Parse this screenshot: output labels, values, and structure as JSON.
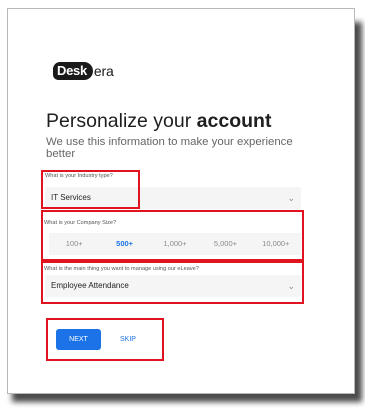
{
  "logo": {
    "badge_text": "Desk",
    "rest_text": "era"
  },
  "heading": {
    "title_prefix": "Personalize your ",
    "title_bold": "account",
    "subtitle": "We use this information to make your experience better"
  },
  "industry": {
    "label": "What is your Industry type?",
    "value": "IT Services"
  },
  "company_size": {
    "label": "What is your Company Size?",
    "options": [
      "100+",
      "500+",
      "1,000+",
      "5,000+",
      "10,000+"
    ],
    "selected": "500+"
  },
  "manage": {
    "label": "What is the main thing you want to manage using our eLeave?",
    "value": "Employee Attendance"
  },
  "actions": {
    "next_label": "NEXT",
    "skip_label": "SKIP"
  },
  "colors": {
    "accent": "#1c73e8",
    "highlight_border": "#e0141e"
  },
  "icons": {
    "dropdown": "chevron-down-icon"
  }
}
